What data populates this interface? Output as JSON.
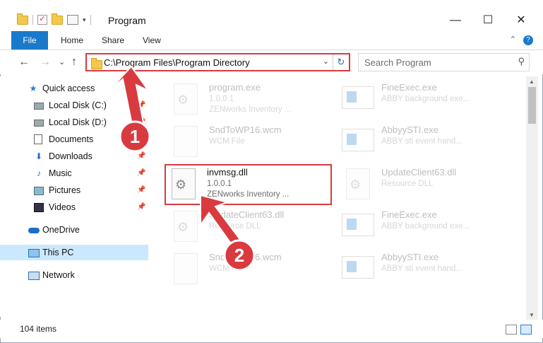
{
  "window": {
    "title": "Program",
    "minimize": "—",
    "maximize": "☐",
    "close": "✕"
  },
  "ribbon": {
    "tabs": [
      "File",
      "Home",
      "Share",
      "View"
    ],
    "help": "?",
    "collapse": "⌃"
  },
  "addressbar": {
    "path": "C:\\Program Files\\Program Directory",
    "refresh": "↻",
    "dropdown": "⌄"
  },
  "search": {
    "placeholder": "Search Program",
    "icon": "⚲"
  },
  "nav_buttons": {
    "back": "←",
    "forward": "→",
    "recent": "⌄",
    "up": "↑"
  },
  "navpane": {
    "quick_access": "Quick access",
    "local_c": "Local Disk (C:)",
    "local_d": "Local Disk (D:)",
    "documents": "Documents",
    "downloads": "Downloads",
    "music": "Music",
    "pictures": "Pictures",
    "videos": "Videos",
    "onedrive": "OneDrive",
    "this_pc": "This PC",
    "network": "Network"
  },
  "files": {
    "f1": {
      "name": "program.exe",
      "line1": "1.0.0.1",
      "line2": "ZENworks Inventory ..."
    },
    "f2": {
      "name": "FineExec.exe",
      "line1": "ABBY background exe..."
    },
    "f3": {
      "name": "SndToWP16.wcm",
      "line1": "WCM File"
    },
    "f4": {
      "name": "AbbyySTI.exe",
      "line1": "ABBY sti event hand..."
    },
    "f5": {
      "name": "invmsg.dll",
      "line1": "1.0.0.1",
      "line2": "ZENworks Inventory ..."
    },
    "f6": {
      "name": "UpdateClient63.dll",
      "line1": "Resource DLL"
    },
    "f7": {
      "name": "UpdateClient63.dll",
      "line1": "Resource DLL"
    },
    "f8": {
      "name": "FineExec.exe",
      "line1": "ABBY background exe..."
    },
    "f9": {
      "name": "SndToWP16.wcm",
      "line1": "WCM File"
    },
    "f10": {
      "name": "AbbyySTI.exe",
      "line1": "ABBY sti event hand..."
    }
  },
  "status": {
    "count": "104 items"
  },
  "annotations": {
    "step1": "1",
    "step2": "2",
    "color": "#d93a3f"
  }
}
